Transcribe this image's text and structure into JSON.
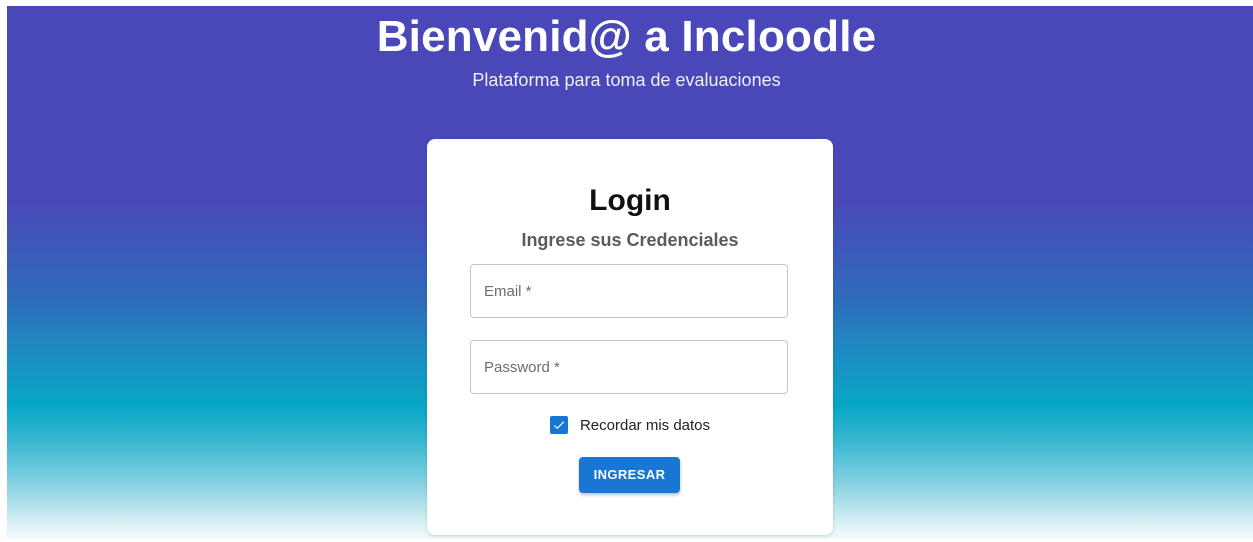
{
  "header": {
    "title": "Bienvenid@ a Incloodle",
    "subtitle": "Plataforma para toma de evaluaciones"
  },
  "login_card": {
    "title": "Login",
    "subtitle": "Ingrese sus Credenciales",
    "email_field": {
      "placeholder": "Email *",
      "value": ""
    },
    "password_field": {
      "placeholder": "Password *",
      "value": ""
    },
    "remember": {
      "label": "Recordar mis datos",
      "checked": true
    },
    "submit_label": "INGRESAR"
  },
  "colors": {
    "accent": "#1976d2",
    "gradient_top": "#4a47b8",
    "gradient_mid": "#07a6c6",
    "gradient_bottom": "#f1fafc"
  },
  "icons": {
    "checkbox": "check-icon"
  }
}
